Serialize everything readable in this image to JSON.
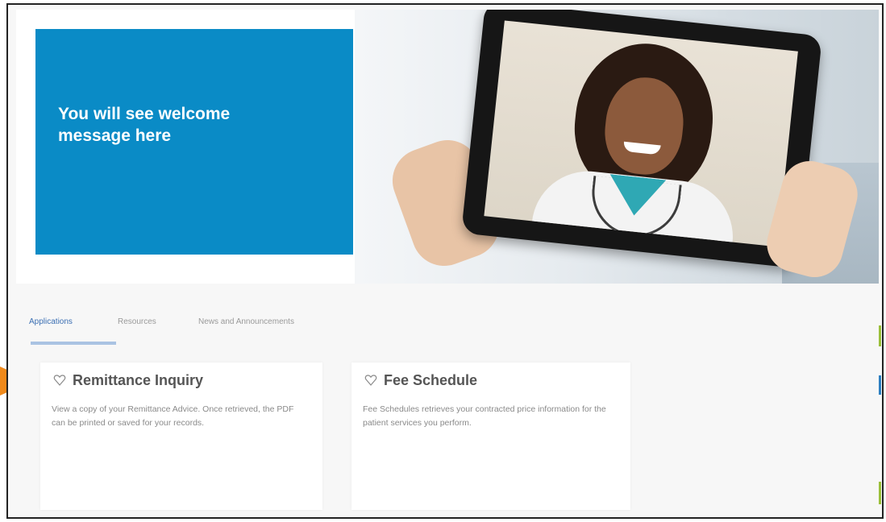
{
  "hero": {
    "welcome_message": "You will see welcome message here"
  },
  "tabs": [
    {
      "label": "Applications",
      "active": true
    },
    {
      "label": "Resources",
      "active": false
    },
    {
      "label": "News and Announcements",
      "active": false
    }
  ],
  "cards": [
    {
      "title": "Remittance Inquiry",
      "icon": "heart-outline-icon",
      "description": "View a copy of your Remittance Advice. Once retrieved, the PDF can be printed or saved for your records."
    },
    {
      "title": "Fee Schedule",
      "icon": "heart-outline-icon",
      "description": "Fee Schedules retrieves your contracted price information for the patient services you perform."
    }
  ],
  "colors": {
    "welcome_box": "#0a8bc6",
    "active_tab": "#3b6fb3",
    "annotation_arrow": "#f08a1c"
  }
}
